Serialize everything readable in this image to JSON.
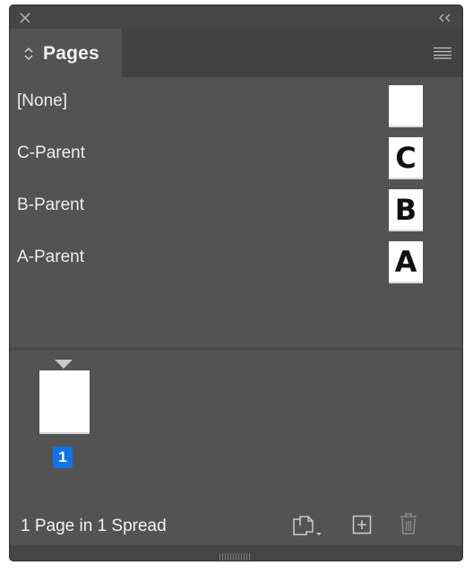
{
  "titlebar": {
    "close_icon": "close-icon",
    "collapse_icon": "double-chevron-left-icon"
  },
  "tab": {
    "label": "Pages",
    "icon": "updown-chevron-icon",
    "menu_icon": "panel-menu-icon"
  },
  "parents": [
    {
      "label": "[None]",
      "thumb_letter": ""
    },
    {
      "label": "C-Parent",
      "thumb_letter": "C"
    },
    {
      "label": "B-Parent",
      "thumb_letter": "B"
    },
    {
      "label": "A-Parent",
      "thumb_letter": "A"
    }
  ],
  "pages": [
    {
      "number": "1",
      "selected": true
    }
  ],
  "footer": {
    "status": "1 Page in 1 Spread",
    "edit_page_size_icon": "edit-page-size-icon",
    "new_page_icon": "new-page-icon",
    "delete_page_icon": "trash-icon"
  },
  "colors": {
    "panel_bg": "#535353",
    "selection": "#1473e6"
  }
}
